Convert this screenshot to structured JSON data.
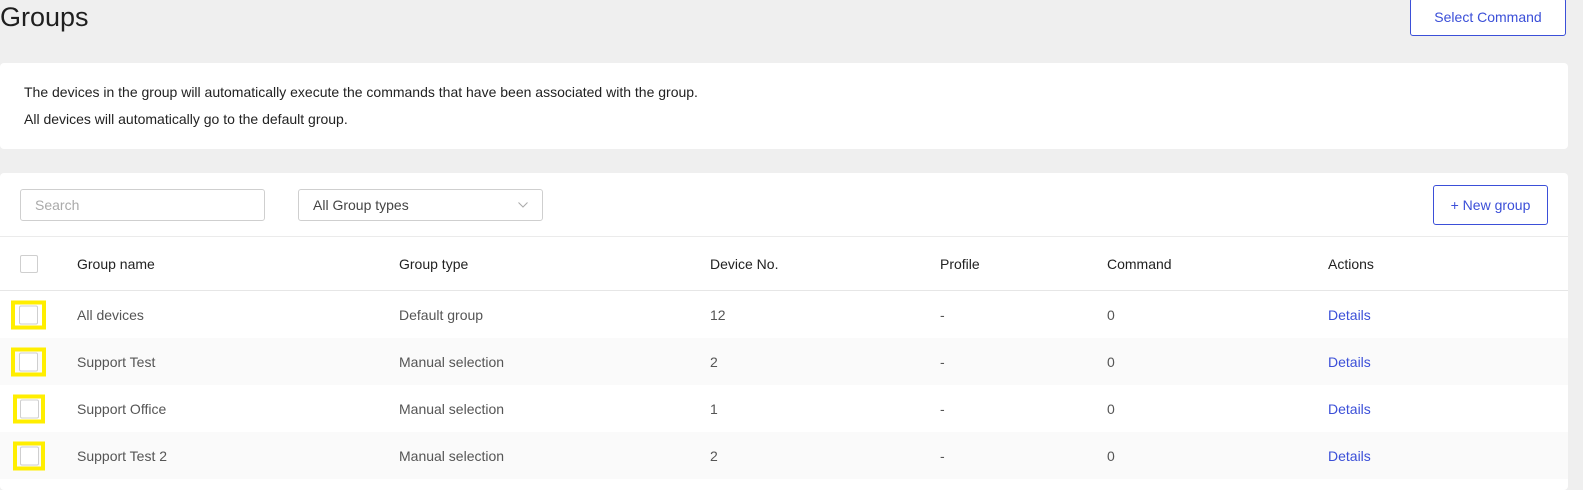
{
  "page": {
    "title": "Groups"
  },
  "header": {
    "select_command_label": "Select Command"
  },
  "info": {
    "line1": "The devices in the group will automatically execute the commands that have been associated with the group.",
    "line2": "All devices will automatically go to the default group."
  },
  "toolbar": {
    "search_placeholder": "Search",
    "group_type_selected": "All Group types",
    "new_group_label": "+ New group"
  },
  "table": {
    "columns": {
      "name": "Group name",
      "type": "Group type",
      "devices": "Device No.",
      "profile": "Profile",
      "command": "Command",
      "actions": "Actions"
    },
    "rows": [
      {
        "name": "All devices",
        "type": "Default group",
        "devices": "12",
        "profile": "-",
        "command": "0",
        "action": "Details"
      },
      {
        "name": "Support Test",
        "type": "Manual selection",
        "devices": "2",
        "profile": "-",
        "command": "0",
        "action": "Details"
      },
      {
        "name": "Support Office",
        "type": "Manual selection",
        "devices": "1",
        "profile": "-",
        "command": "0",
        "action": "Details"
      },
      {
        "name": "Support Test 2",
        "type": "Manual selection",
        "devices": "2",
        "profile": "-",
        "command": "0",
        "action": "Details"
      }
    ]
  },
  "colors": {
    "accent": "#3b4fd8",
    "highlight": "#ffee00",
    "background": "#efefef"
  },
  "icons": {
    "dropdown": "chevron-down-icon"
  }
}
